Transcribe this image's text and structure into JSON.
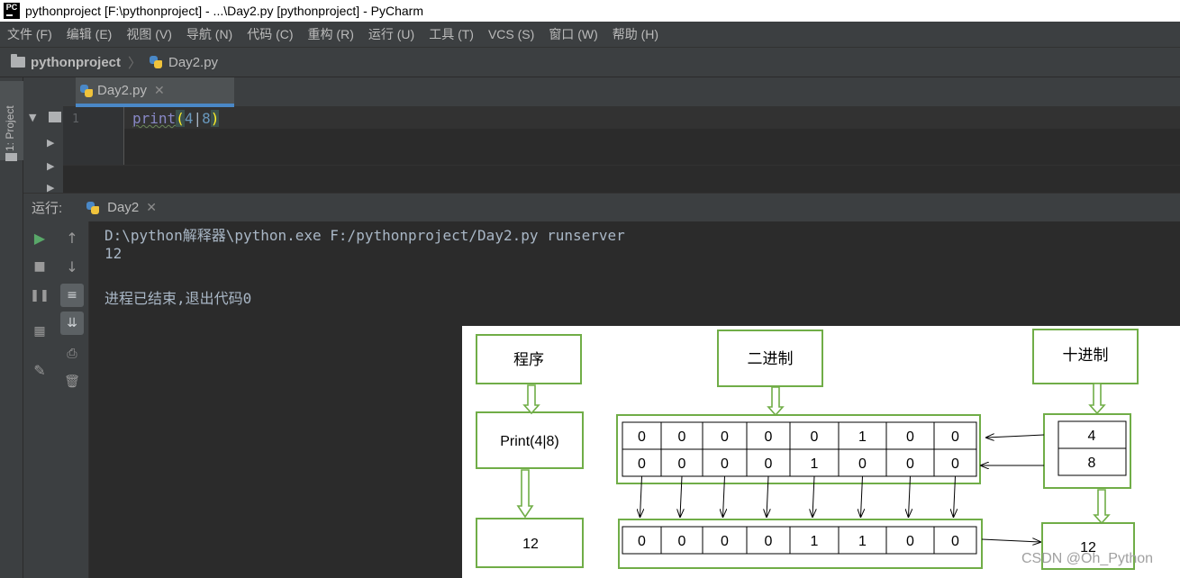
{
  "window": {
    "title": "pythonproject [F:\\pythonproject] - ...\\Day2.py [pythonproject] - PyCharm",
    "app_icon_text": "PC"
  },
  "menu": [
    "文件 (F)",
    "编辑 (E)",
    "视图 (V)",
    "导航 (N)",
    "代码 (C)",
    "重构 (R)",
    "运行 (U)",
    "工具 (T)",
    "VCS (S)",
    "窗口 (W)",
    "帮助 (H)"
  ],
  "breadcrumb": {
    "project": "pythonproject",
    "file": "Day2.py"
  },
  "left_strip": {
    "project_tab_label": "1: Project"
  },
  "editor": {
    "tab_label": "Day2.py",
    "line_number": "1",
    "code": {
      "fn": "print",
      "open": "(",
      "a": "4",
      "op": "|",
      "b": "8",
      "close": ")"
    }
  },
  "run": {
    "label": "运行:",
    "tab_label": "Day2",
    "console": [
      "D:\\python解释器\\python.exe F:/pythonproject/Day2.py runserver",
      "12",
      "",
      "进程已结束,退出代码0"
    ]
  },
  "diagram": {
    "box_program": "程序",
    "box_binary": "二进制",
    "box_decimal": "十进制",
    "box_expr": "Print(4|8)",
    "box_result": "12",
    "decimal_values": [
      "4",
      "8"
    ],
    "decimal_result": "12",
    "bits_4": [
      "0",
      "0",
      "0",
      "0",
      "0",
      "1",
      "0",
      "0"
    ],
    "bits_8": [
      "0",
      "0",
      "0",
      "0",
      "1",
      "0",
      "0",
      "0"
    ],
    "bits_result": [
      "0",
      "0",
      "0",
      "0",
      "1",
      "1",
      "0",
      "0"
    ],
    "colors": {
      "box_border": "#70ad47",
      "grid_border": "#000000"
    }
  },
  "watermark": "CSDN @Oh_Python"
}
